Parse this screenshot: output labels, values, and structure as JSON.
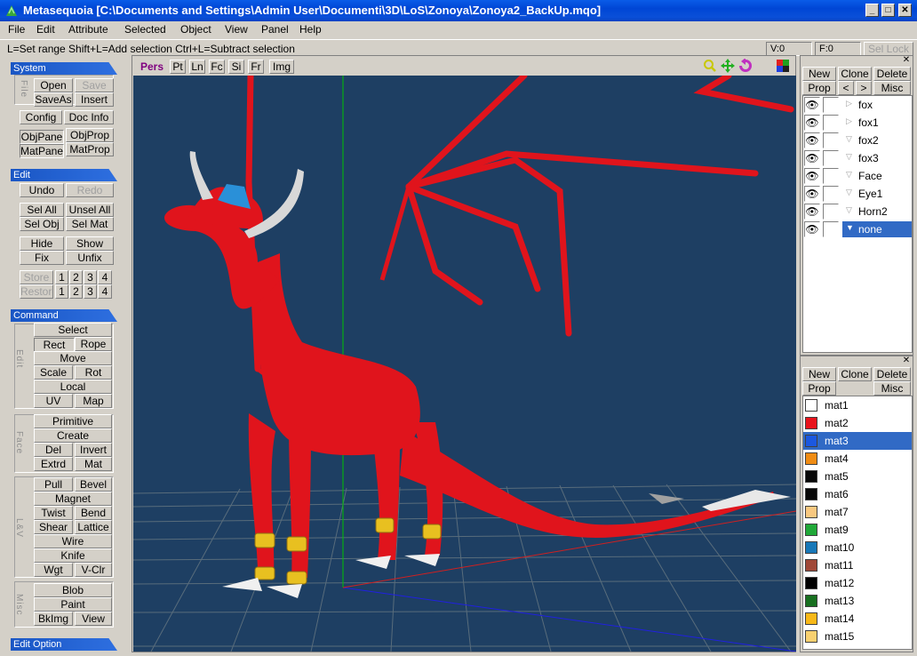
{
  "window": {
    "title": "Metasequoia [C:\\Documents and Settings\\Admin User\\Documenti\\3D\\LoS\\Zonoya\\Zonoya2_BackUp.mqo]",
    "minimize": "_",
    "maximize": "□",
    "close": "✕"
  },
  "menu": [
    "File",
    "Edit",
    "Attribute",
    "Selected",
    "Object",
    "View",
    "Panel",
    "Help"
  ],
  "hint": "L=Set range  Shift+L=Add selection  Ctrl+L=Subtract selection",
  "status": {
    "vertices": "V:0",
    "faces": "F:0",
    "sel_lock": "Sel Lock"
  },
  "left": {
    "system_header": "System",
    "file_label": "File",
    "open": "Open",
    "save": "Save",
    "saveas": "SaveAs",
    "insert": "Insert",
    "config": "Config",
    "docinfo": "Doc Info",
    "objpane": "ObjPane",
    "objprop": "ObjProp",
    "matpane": "MatPane",
    "matprop": "MatProp",
    "edit_header": "Edit",
    "undo": "Undo",
    "redo": "Redo",
    "selall": "Sel All",
    "unselall": "Unsel All",
    "selobj": "Sel Obj",
    "selmat": "Sel Mat",
    "hide": "Hide",
    "show": "Show",
    "fix": "Fix",
    "unfix": "Unfix",
    "store": "Store",
    "restore": "Restore",
    "n1": "1",
    "n2": "2",
    "n3": "3",
    "n4": "4",
    "command_header": "Command",
    "edit_label": "Edit",
    "face_label": "Face",
    "lv_label": "L&V",
    "misc_label": "Misc",
    "select": "Select",
    "rect": "Rect",
    "rope": "Rope",
    "move": "Move",
    "scale": "Scale",
    "rot": "Rot",
    "local": "Local",
    "uv": "UV",
    "map": "Map",
    "primitive": "Primitive",
    "create": "Create",
    "del": "Del",
    "invert": "Invert",
    "extrd": "Extrd",
    "mat": "Mat",
    "pull": "Pull",
    "bevel": "Bevel",
    "magnet": "Magnet",
    "twist": "Twist",
    "bend": "Bend",
    "shear": "Shear",
    "lattice": "Lattice",
    "wire": "Wire",
    "knife": "Knife",
    "wgt": "Wgt",
    "vclr": "V-Clr",
    "blob": "Blob",
    "paint": "Paint",
    "bkimg": "BkImg",
    "view": "View",
    "editoption_header": "Edit Option"
  },
  "viewport": {
    "tabs": [
      "Pers",
      "Pt",
      "Ln",
      "Fc",
      "Si",
      "Fr",
      "Img"
    ],
    "icons": [
      "zoom-icon",
      "move-view-icon",
      "rotate-view-icon",
      "color-grid-icon"
    ]
  },
  "objects": {
    "buttons": {
      "new": "New",
      "clone": "Clone",
      "delete": "Delete",
      "prop": "Prop",
      "prev": "<",
      "next": ">",
      "misc": "Misc"
    },
    "items": [
      {
        "name": "fox",
        "arrow": "▷"
      },
      {
        "name": "fox1",
        "arrow": "▷"
      },
      {
        "name": "fox2",
        "arrow": "▽"
      },
      {
        "name": "fox3",
        "arrow": "▽"
      },
      {
        "name": "Face",
        "arrow": "▽"
      },
      {
        "name": "Eye1",
        "arrow": "▽"
      },
      {
        "name": "Horn2",
        "arrow": "▽"
      },
      {
        "name": "none",
        "arrow": "▼"
      }
    ],
    "selected": "none"
  },
  "materials": {
    "buttons": {
      "new": "New",
      "clone": "Clone",
      "delete": "Delete",
      "prop": "Prop",
      "misc": "Misc"
    },
    "items": [
      {
        "name": "mat1",
        "color": "#ffffff"
      },
      {
        "name": "mat2",
        "color": "#e8141c"
      },
      {
        "name": "mat3",
        "color": "#1c58e0"
      },
      {
        "name": "mat4",
        "color": "#f08c14"
      },
      {
        "name": "mat5",
        "color": "#080808"
      },
      {
        "name": "mat6",
        "color": "#080808"
      },
      {
        "name": "mat7",
        "color": "#f8c880"
      },
      {
        "name": "mat9",
        "color": "#20a838"
      },
      {
        "name": "mat10",
        "color": "#1878b8"
      },
      {
        "name": "mat11",
        "color": "#a04838"
      },
      {
        "name": "mat12",
        "color": "#000000"
      },
      {
        "name": "mat13",
        "color": "#187020"
      },
      {
        "name": "mat14",
        "color": "#f8b818"
      },
      {
        "name": "mat15",
        "color": "#f8d070"
      }
    ],
    "selected": "mat3"
  },
  "colors": {
    "titlebar": "#0046d5",
    "scene_bg": "#1e3f63",
    "dragon_red": "#e8141c",
    "selection": "#316ac5"
  }
}
